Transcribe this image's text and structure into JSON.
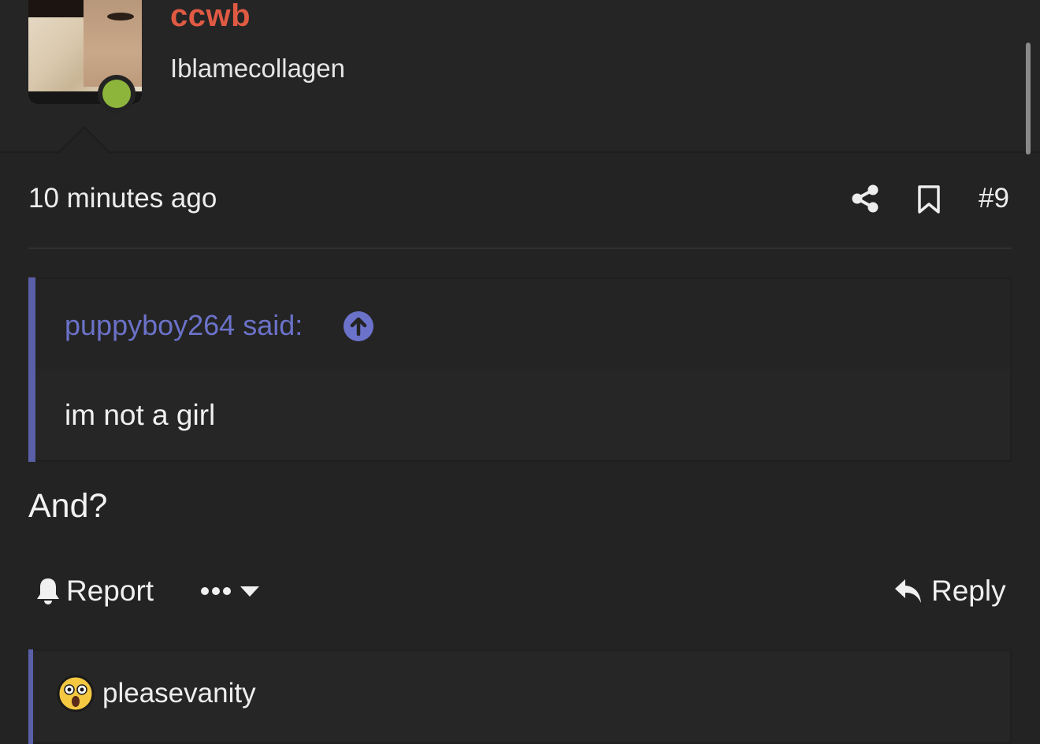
{
  "user": {
    "username": "ccwb",
    "title": "Iblamecollagen",
    "avatar_icon": "user-avatar",
    "online_color": "#8db53c",
    "username_color": "#e05a43"
  },
  "post": {
    "time": "10 minutes ago",
    "number": "#9",
    "share_icon": "share-icon",
    "bookmark_icon": "bookmark-icon",
    "quote": {
      "author": "puppyboy264 said:",
      "text": "im not a girl",
      "accent_color": "#5a5fa8"
    },
    "body": "And?"
  },
  "actions": {
    "report_label": "Report",
    "reply_label": "Reply"
  },
  "next_quote": {
    "author": "pleasevanity",
    "avatar_icon": "shocked-face-emoji"
  }
}
